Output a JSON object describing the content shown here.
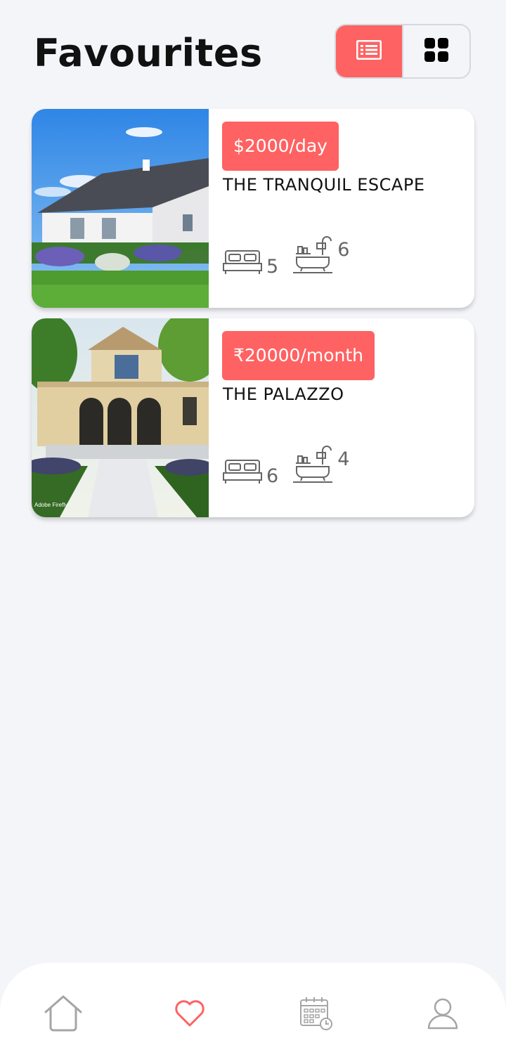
{
  "header": {
    "title": "Favourites",
    "view_toggle": {
      "list_icon": "list-view-icon",
      "grid_icon": "grid-view-icon",
      "active": "list"
    }
  },
  "favourites": [
    {
      "price": "$2000/day",
      "name": "THE TRANQUIL ESCAPE",
      "beds": "5",
      "baths": "6"
    },
    {
      "price": "₹20000/month",
      "name": "THE PALAZZO",
      "beds": "6",
      "baths": "4"
    }
  ],
  "bottom_nav": {
    "items": [
      "home-icon",
      "heart-icon",
      "calendar-icon",
      "profile-icon"
    ],
    "active": "favourites"
  },
  "colors": {
    "accent": "#fe6262",
    "background": "#f4f5f9",
    "card": "#ffffff"
  }
}
